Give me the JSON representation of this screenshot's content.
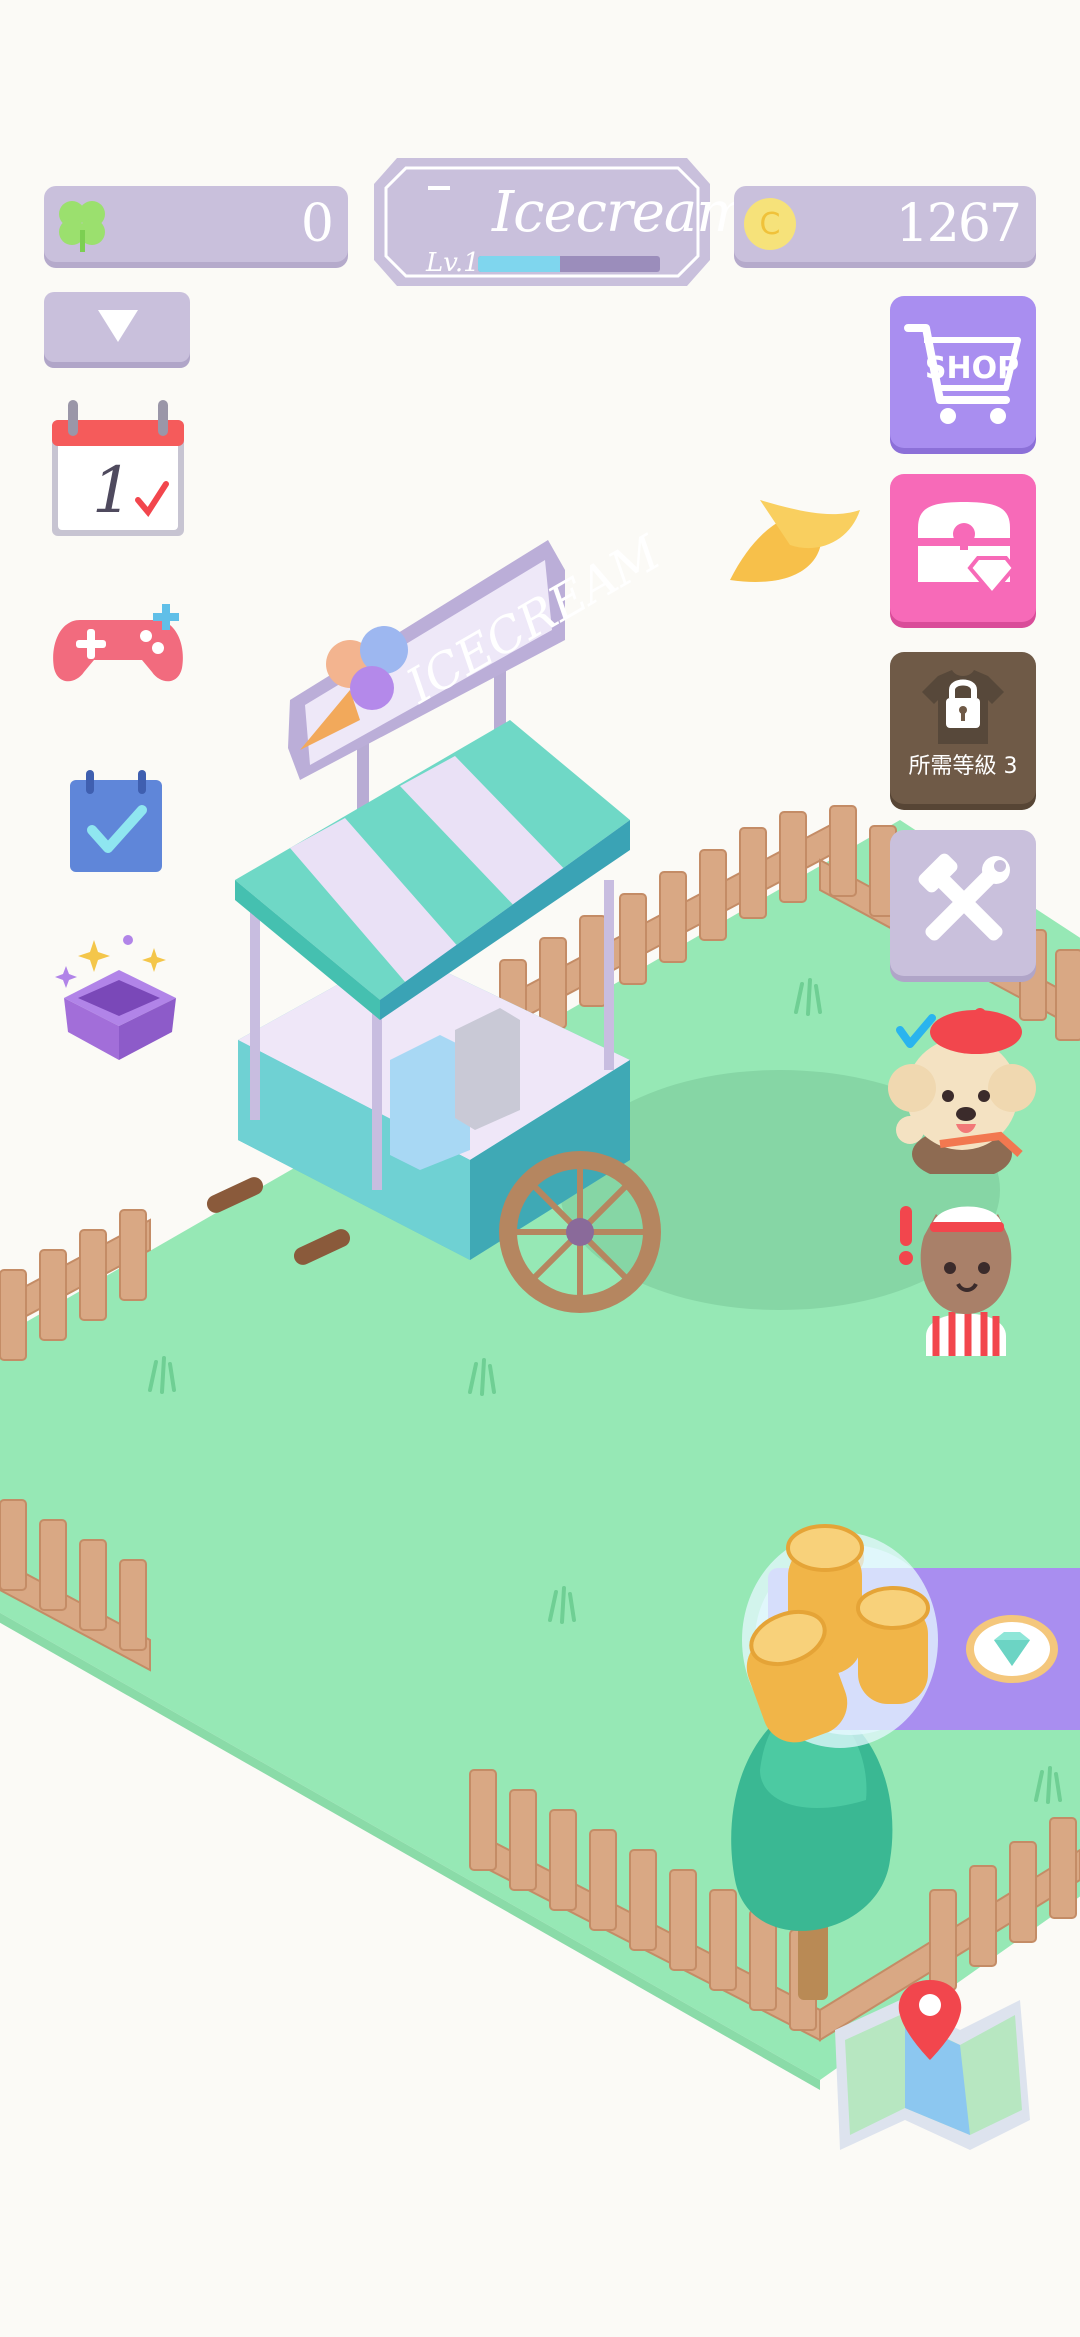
{
  "top_bar": {
    "clover_count": "0",
    "stand_name": "Icecream",
    "level_label": "Lv.1",
    "xp_progress": 0.45,
    "coin_count": "1267"
  },
  "right_menu": {
    "shop_label": "SHOP",
    "locked_label": "所需等級 3"
  },
  "cart_sign": "ICECREAM",
  "calendar_day": "1",
  "colors": {
    "panel": "#c9c0dc",
    "shop": "#a98ef0",
    "treasure": "#f76ab8",
    "locked": "#6f5a47",
    "grass": "#96e8b5",
    "fence": "#d9a884"
  },
  "icons": [
    "clover-icon",
    "coin-icon",
    "dropdown-arrow-icon",
    "calendar-icon",
    "gamepad-icon",
    "checklist-icon",
    "gift-box-icon",
    "shop-cart-icon",
    "treasure-chest-icon",
    "lock-icon",
    "tools-icon",
    "banana-icon",
    "dog-customer-icon",
    "cat-customer-icon",
    "coins-stack-icon",
    "diamond-icon",
    "map-icon"
  ]
}
